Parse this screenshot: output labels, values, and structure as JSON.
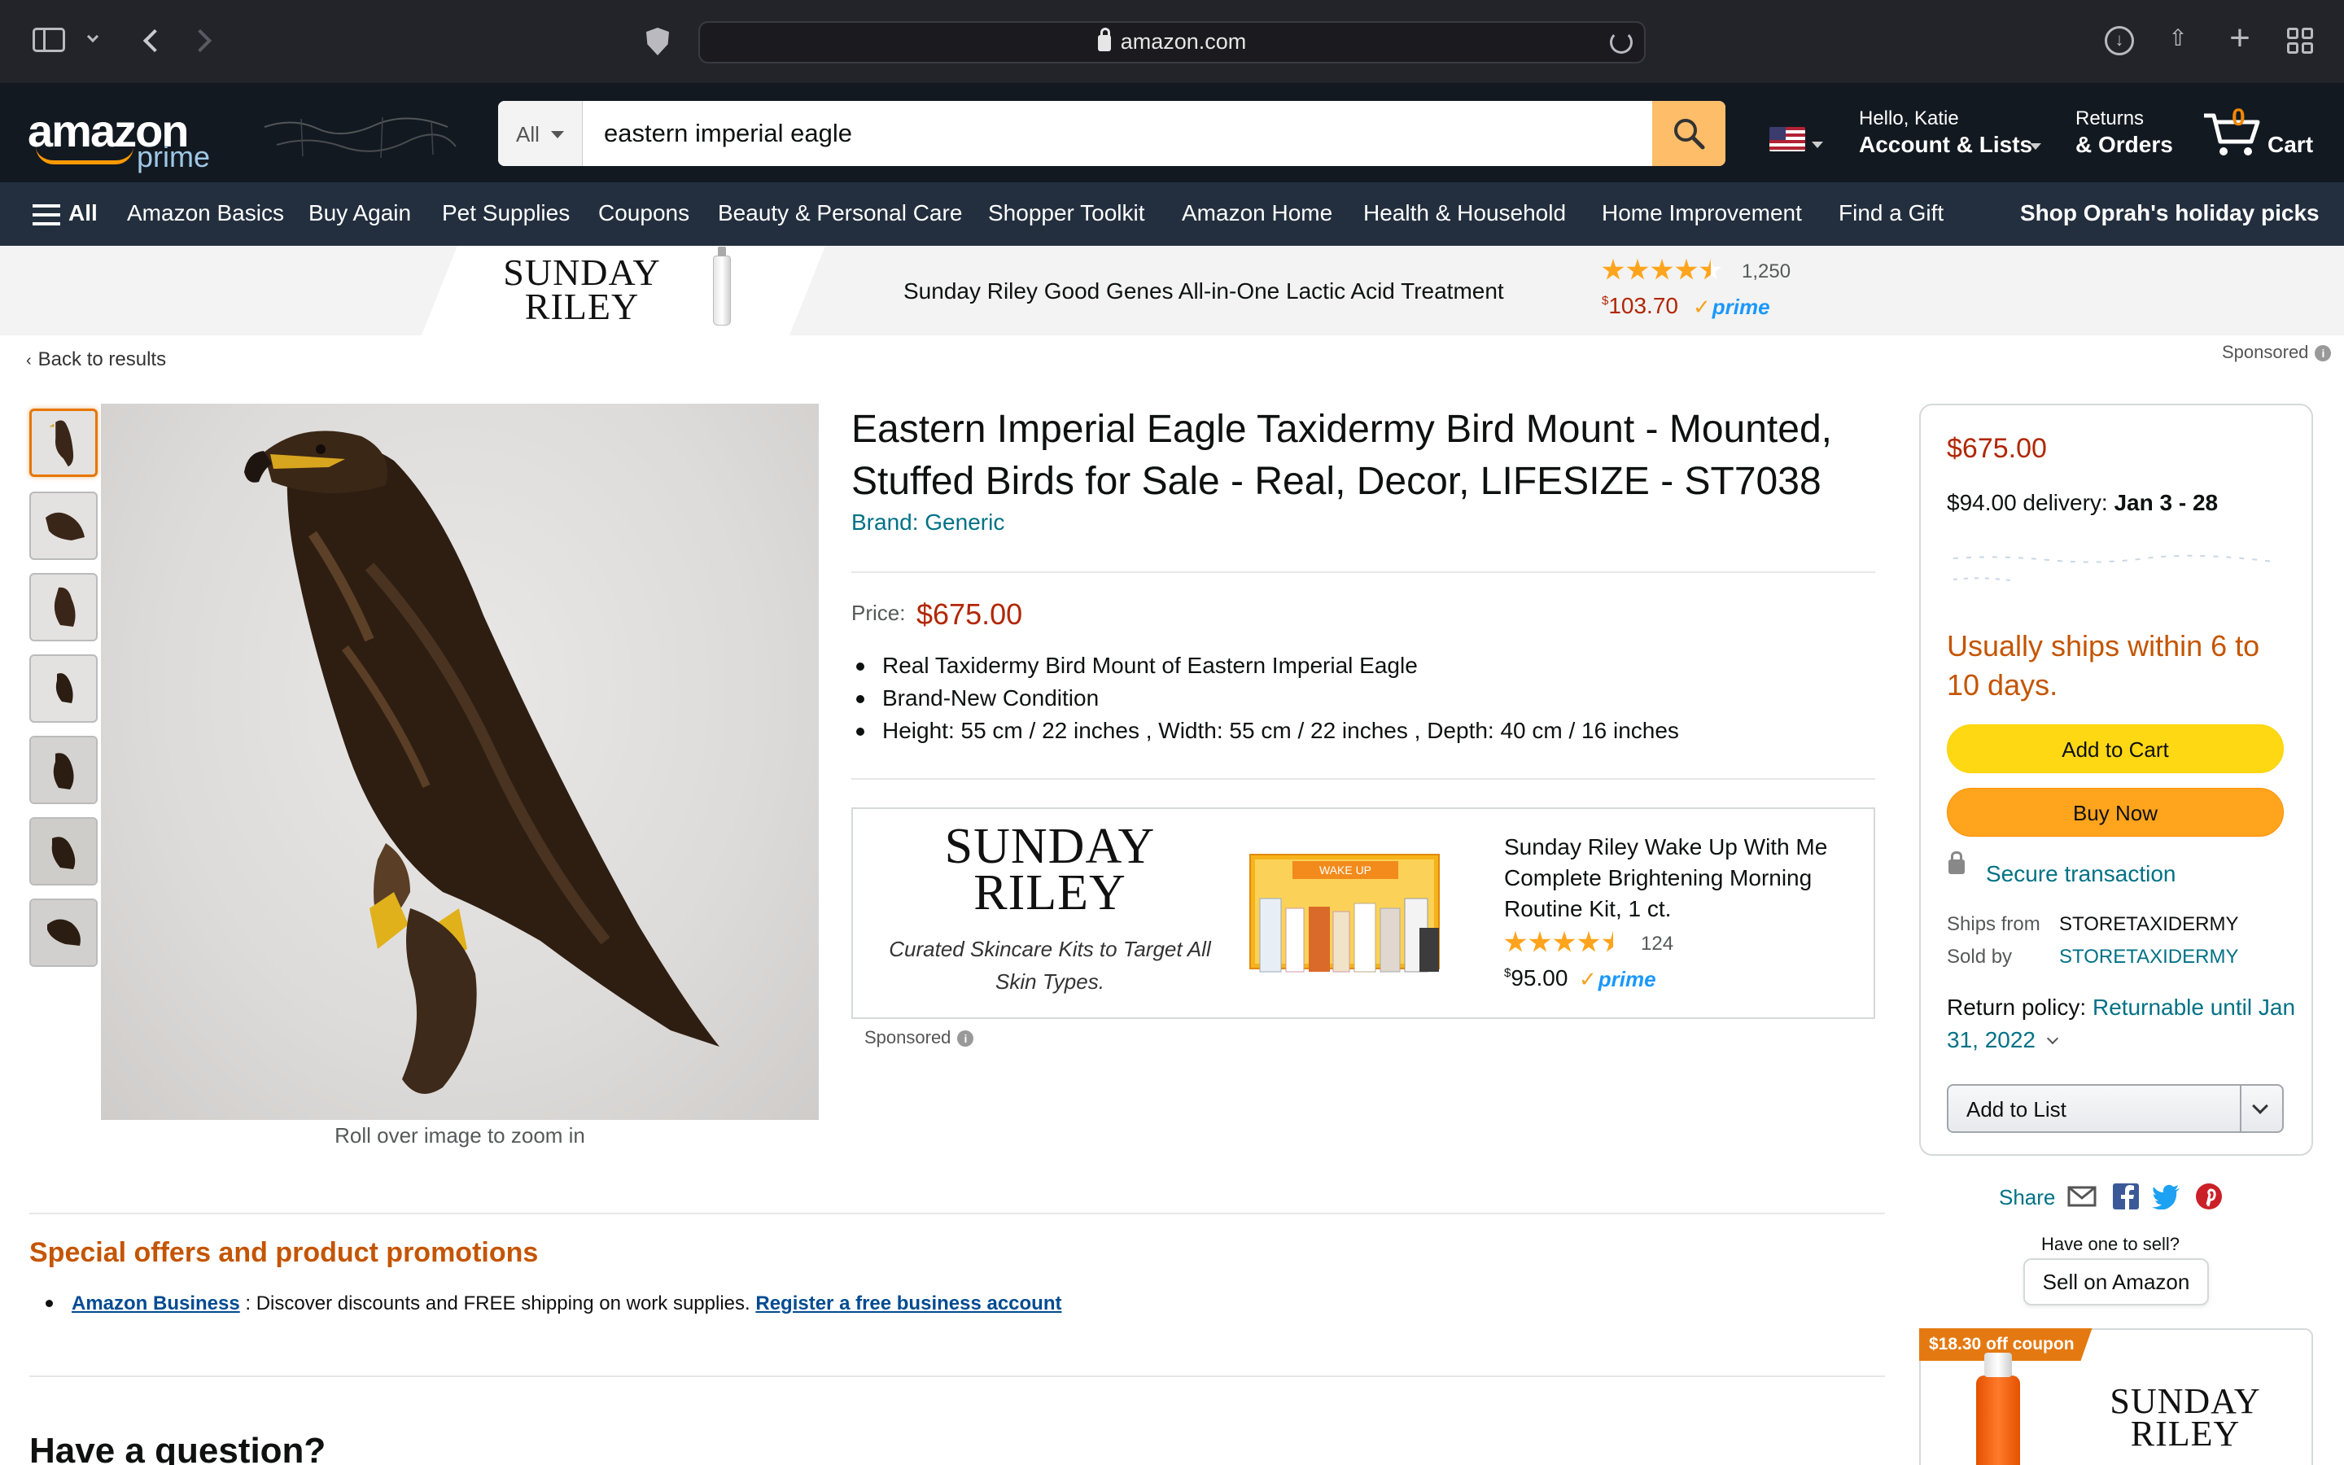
{
  "browser": {
    "url": "amazon.com",
    "icons": [
      "sidebar-icon",
      "chevron-down-icon",
      "back-icon",
      "forward-icon",
      "shield-icon",
      "reload-icon",
      "download-icon",
      "share-icon",
      "plus-icon",
      "tabs-grid-icon"
    ]
  },
  "header": {
    "logo_text": "amazon",
    "logo_sub": "prime",
    "search": {
      "category": "All",
      "query": "eastern imperial eagle"
    },
    "account_line1": "Hello, Katie",
    "account_line2": "Account & Lists",
    "returns_line1": "Returns",
    "returns_line2": "& Orders",
    "cart_count": "0",
    "cart_label": "Cart"
  },
  "nav": {
    "all_label": "All",
    "links": [
      "Amazon Basics",
      "Buy Again",
      "Pet Supplies",
      "Coupons",
      "Beauty & Personal Care",
      "Shopper Toolkit",
      "Amazon Home",
      "Health & Household",
      "Home Improvement",
      "Find a Gift"
    ],
    "promo": "Shop Oprah's holiday picks"
  },
  "top_ad": {
    "brand_line1": "SUNDAY",
    "brand_line2": "RILEY",
    "title": "Sunday Riley Good Genes All-in-One Lactic Acid Treatment",
    "rating": 4.5,
    "rating_count": "1,250",
    "price_symbol": "$",
    "price": "103.70",
    "prime": "prime"
  },
  "breadcrumb": {
    "back": "Back to results",
    "sponsored": "Sponsored"
  },
  "gallery": {
    "thumbnail_count": 7,
    "active_index": 0,
    "zoom_hint": "Roll over image to zoom in"
  },
  "product": {
    "title": "Eastern Imperial Eagle Taxidermy Bird Mount - Mounted, Stuffed Birds for Sale - Real, Decor, LIFESIZE - ST7038",
    "brand": "Brand: Generic",
    "price_label": "Price:",
    "price": "$675.00",
    "bullets": [
      "Real Taxidermy Bird Mount of Eastern Imperial Eagle",
      "Brand-New Condition",
      "Height: 55 cm / 22 inches , Width: 55 cm / 22 inches , Depth: 40 cm / 16 inches"
    ]
  },
  "center_ad": {
    "brand_line1": "SUNDAY",
    "brand_line2": "RILEY",
    "tagline": "Curated Skincare Kits to Target All Skin Types.",
    "kit_label": "WAKE UP",
    "title": "Sunday Riley Wake Up With Me Complete Brightening Morning Routine Kit, 1 ct.",
    "rating": 4.5,
    "rating_count": "124",
    "price_symbol": "$",
    "price": "95.00",
    "prime": "prime",
    "sponsored": "Sponsored"
  },
  "buybox": {
    "price": "$675.00",
    "delivery_prefix": "$94.00 delivery:",
    "delivery_dates": "Jan 3 - 28",
    "ships_note": "Usually ships within 6 to 10 days.",
    "add_to_cart": "Add to Cart",
    "buy_now": "Buy Now",
    "secure": "Secure transaction",
    "ships_from_label": "Ships from",
    "ships_from": "STORETAXIDERMY",
    "sold_by_label": "Sold by",
    "sold_by": "STORETAXIDERMY",
    "return_label": "Return policy:",
    "return_link": "Returnable until Jan 31, 2022",
    "add_to_list": "Add to List"
  },
  "share": {
    "label": "Share",
    "icons": [
      "email-icon",
      "facebook-icon",
      "twitter-icon",
      "pinterest-icon"
    ],
    "have_one": "Have one to sell?",
    "sell_button": "Sell on Amazon"
  },
  "coupon_ad": {
    "coupon": "$18.30 off coupon",
    "brand_line1": "SUNDAY",
    "brand_line2": "RILEY"
  },
  "offers": {
    "heading": "Special offers and product promotions",
    "link1": "Amazon Business",
    "text": " : Discover discounts and FREE shipping on work supplies. ",
    "link2": "Register a free business account"
  },
  "question": {
    "heading": "Have a question?"
  },
  "colors": {
    "header_bg": "#131921",
    "nav_bg": "#232f3e",
    "price_red": "#b12704",
    "link_teal": "#007185",
    "add_to_cart": "#ffd814",
    "buy_now": "#ffa41c",
    "offer_orange": "#c45500"
  }
}
